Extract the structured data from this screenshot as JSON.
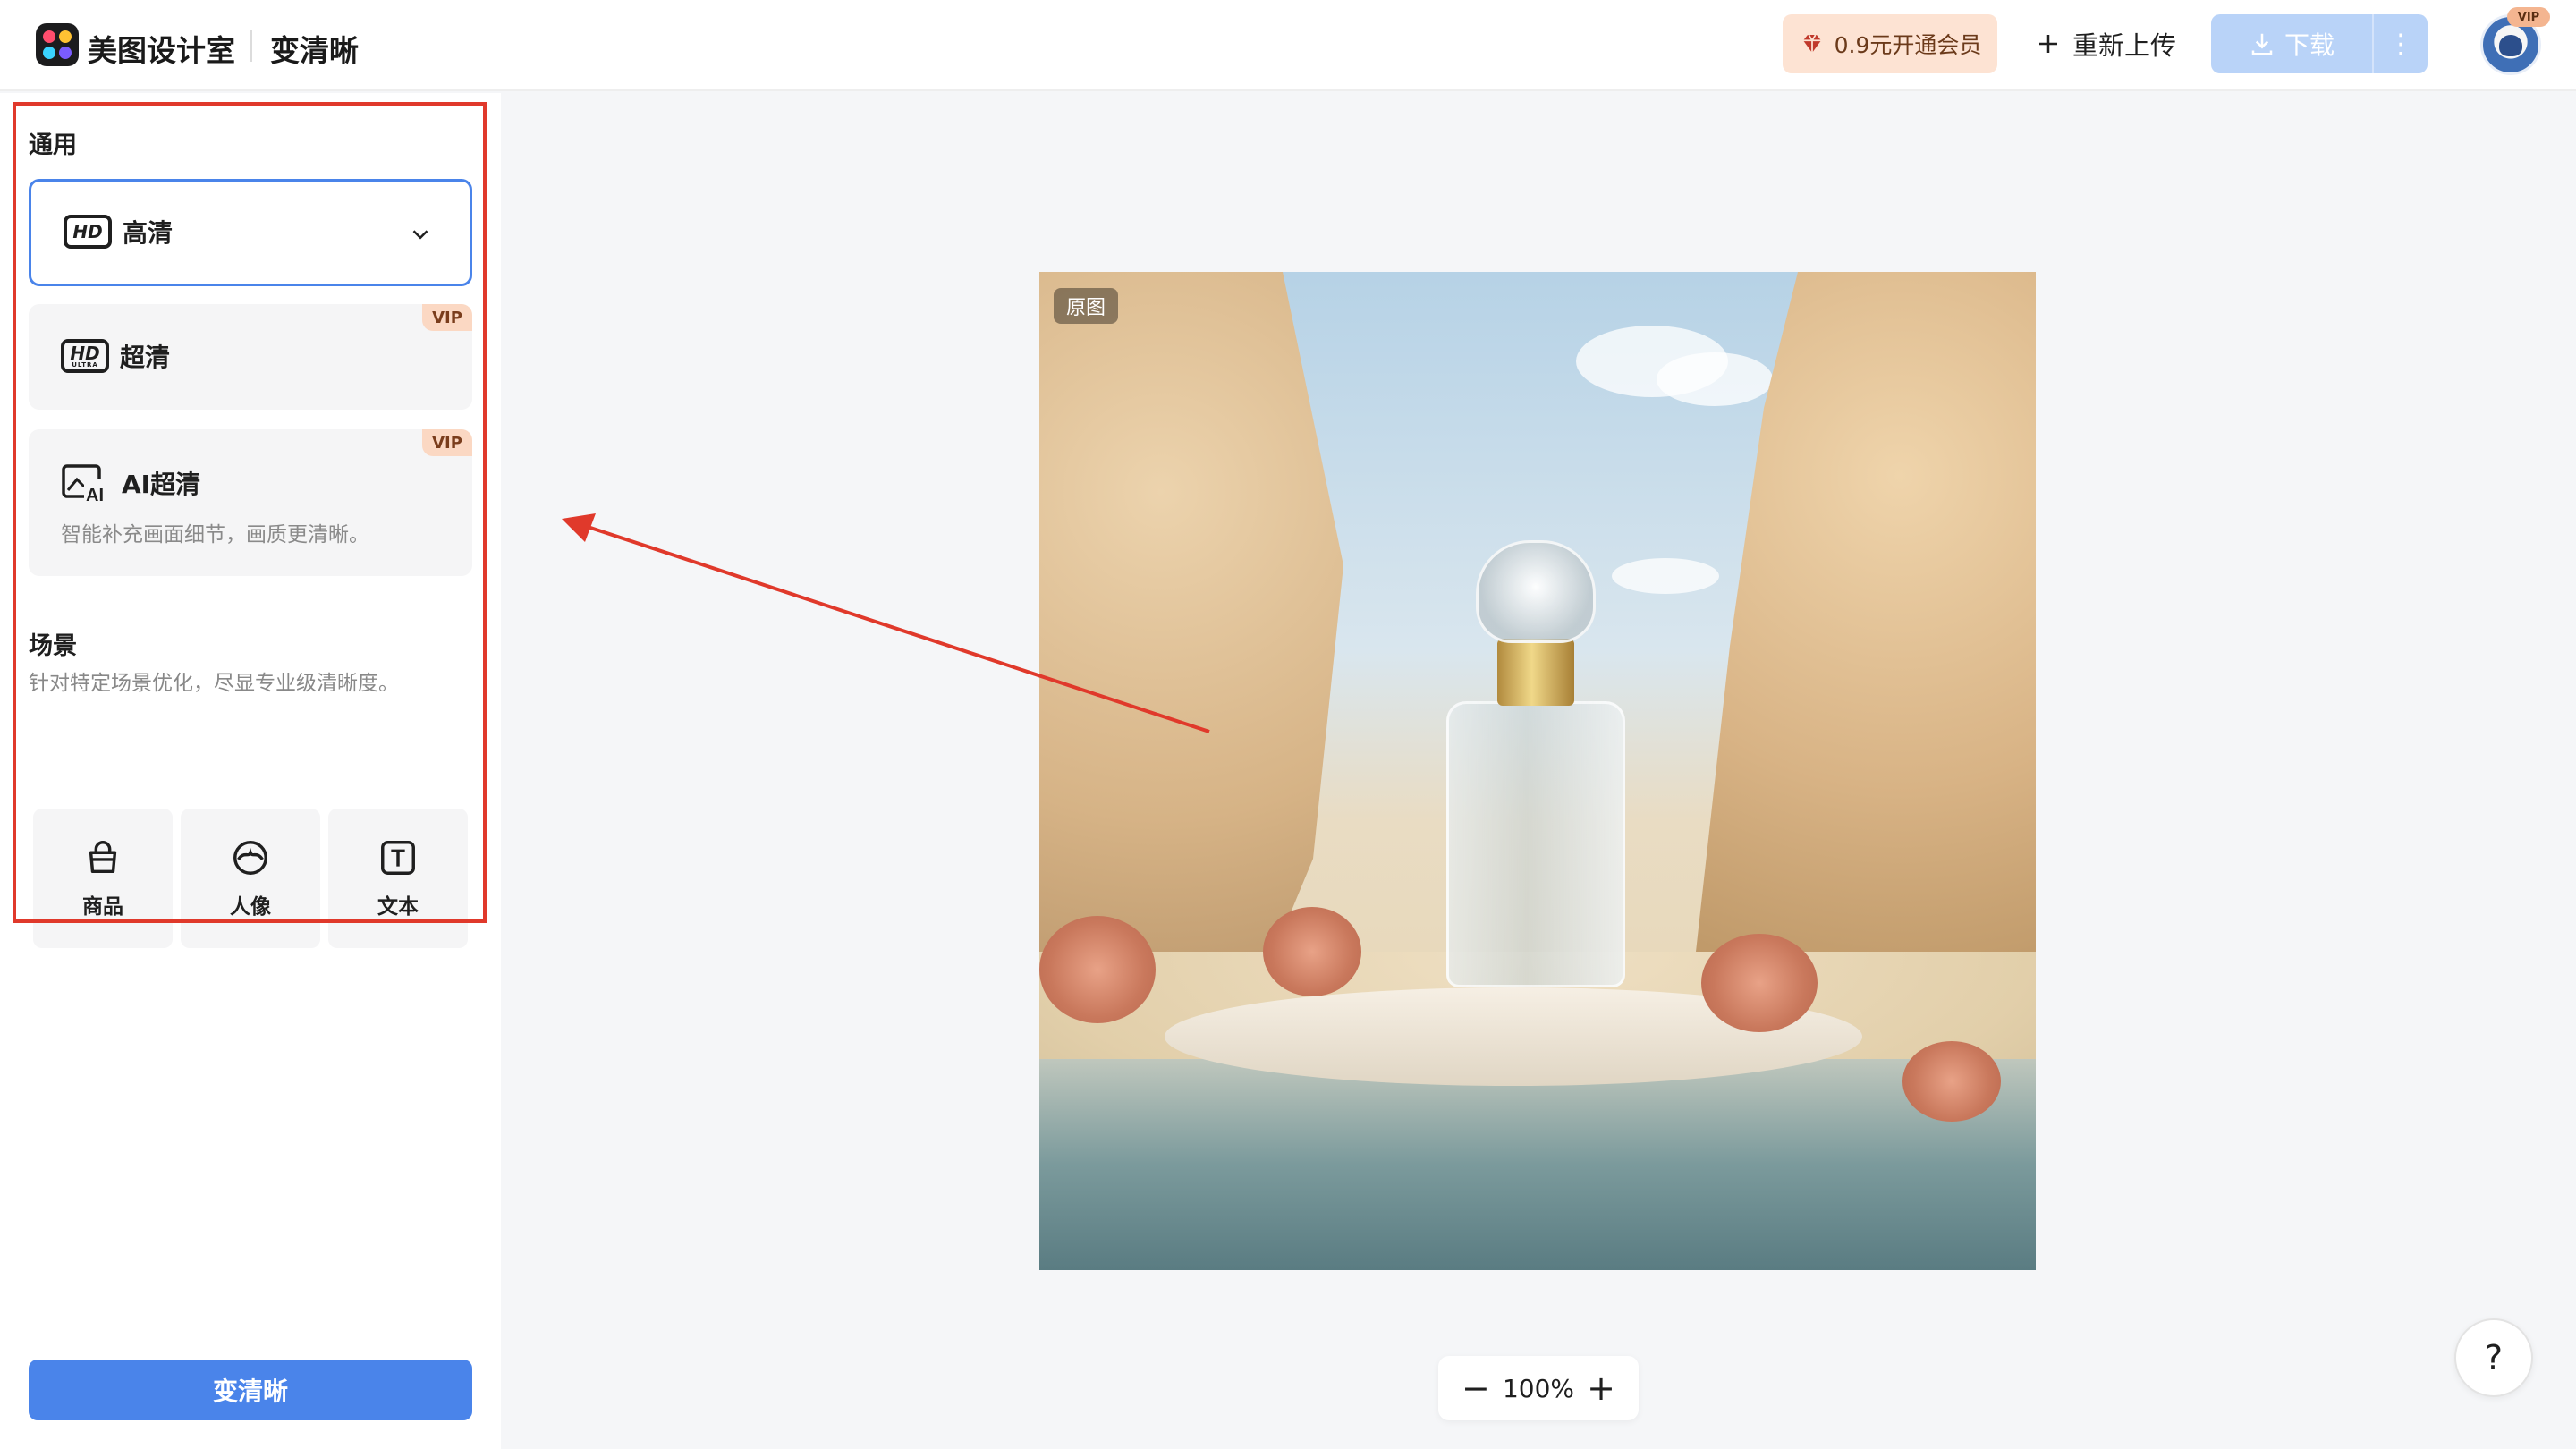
{
  "header": {
    "brand": "美图设计室",
    "page_name": "变清晰",
    "vip_promo": "0.9元开通会员",
    "reupload": "重新上传",
    "download": "下载",
    "avatar_badge": "VIP"
  },
  "sidebar": {
    "general_title": "通用",
    "options": [
      {
        "label": "高清",
        "selected": true
      },
      {
        "label": "超清",
        "vip": "VIP"
      },
      {
        "label": "AI超清",
        "vip": "VIP",
        "desc": "智能补充画面细节，画质更清晰。"
      }
    ],
    "scene_title": "场景",
    "scene_desc": "针对特定场景优化，尽显专业级清晰度。",
    "scenes": [
      {
        "label": "商品"
      },
      {
        "label": "人像"
      },
      {
        "label": "文本"
      }
    ],
    "primary_button": "变清晰"
  },
  "canvas": {
    "image_tag": "原图",
    "zoom_level": "100%",
    "zoom_out_symbol": "−",
    "zoom_in_symbol": "+",
    "help_symbol": "?"
  },
  "colors": {
    "accent": "#4a84ea",
    "highlight": "#e0392b",
    "vip_bg": "#fde3d3"
  }
}
